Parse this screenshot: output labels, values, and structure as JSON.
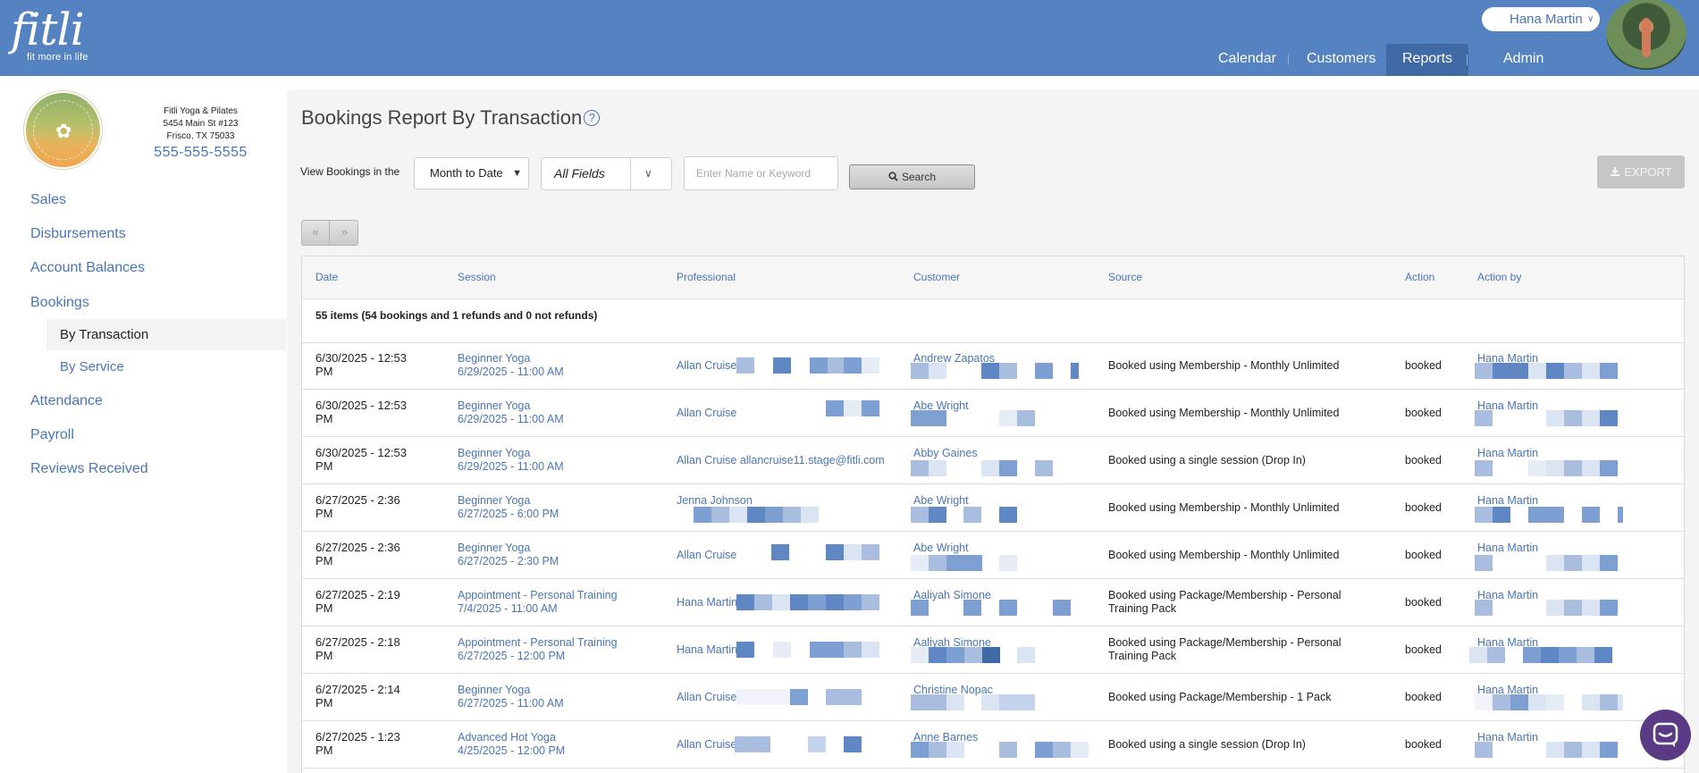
{
  "brand": {
    "name": "fitli",
    "tagline": "fit more in life"
  },
  "user": {
    "name": "Hana Martin"
  },
  "nav": [
    {
      "label": "Calendar",
      "active": false
    },
    {
      "label": "Customers",
      "active": false
    },
    {
      "label": "Reports",
      "active": true
    },
    {
      "label": "Admin",
      "active": false
    }
  ],
  "studio": {
    "name": "Fitli Yoga & Pilates",
    "address1": "5454 Main St #123",
    "address2": "Frisco, TX 75033",
    "phone": "555-555-5555"
  },
  "sidebar": {
    "items": [
      "Sales",
      "Disbursements",
      "Account Balances",
      "Bookings"
    ],
    "sub_items": [
      {
        "label": "By Transaction",
        "active": true
      },
      {
        "label": "By Service",
        "active": false
      }
    ],
    "items_after": [
      "Attendance",
      "Payroll",
      "Reviews Received"
    ]
  },
  "page": {
    "title": "Bookings Report By Transaction",
    "help": "?"
  },
  "filters": {
    "view_label": "View Bookings in the",
    "period": "Month to Date",
    "fields": "All Fields",
    "keyword_placeholder": "Enter Name or Keyword",
    "search_label": "Search",
    "export_label": "EXPORT"
  },
  "pager": {
    "prev": "«",
    "next": "»"
  },
  "table": {
    "columns": [
      "Date",
      "Session",
      "Professional",
      "Customer",
      "Source",
      "Action",
      "Action by"
    ],
    "summary": "55 items (54 bookings and 1 refunds and 0 not refunds)",
    "rows": [
      {
        "date": "6/30/2025 - 12:53",
        "date2": "PM",
        "session": "Beginner Yoga",
        "session_time": "6/29/2025 - 11:00 AM",
        "professional": "Allan Cruise",
        "customer": "Andrew Zapatos",
        "source": "Booked using Membership - Monthly Unlimited",
        "source2": "",
        "action": "booked",
        "action_by": "Hana Martin"
      },
      {
        "date": "6/30/2025 - 12:53",
        "date2": "PM",
        "session": "Beginner Yoga",
        "session_time": "6/29/2025 - 11:00 AM",
        "professional": "Allan Cruise",
        "customer": "Abe Wright",
        "source": "Booked using Membership - Monthly Unlimited",
        "source2": "",
        "action": "booked",
        "action_by": "Hana Martin"
      },
      {
        "date": "6/30/2025 - 12:53",
        "date2": "PM",
        "session": "Beginner Yoga",
        "session_time": "6/29/2025 - 11:00 AM",
        "professional": "Allan Cruise allancruise11.stage@fitli.com",
        "customer": "Abby Gaines",
        "source": "Booked using a single session (Drop In)",
        "source2": "",
        "action": "booked",
        "action_by": "Hana Martin"
      },
      {
        "date": "6/27/2025 - 2:36",
        "date2": "PM",
        "session": "Beginner Yoga",
        "session_time": "6/27/2025 - 6:00 PM",
        "professional": "Jenna Johnson",
        "customer": "Abe Wright",
        "source": "Booked using Membership - Monthly Unlimited",
        "source2": "",
        "action": "booked",
        "action_by": "Hana Martin"
      },
      {
        "date": "6/27/2025 - 2:36",
        "date2": "PM",
        "session": "Beginner Yoga",
        "session_time": "6/27/2025 - 2:30 PM",
        "professional": "Allan Cruise",
        "customer": "Abe Wright",
        "source": "Booked using Membership - Monthly Unlimited",
        "source2": "",
        "action": "booked",
        "action_by": "Hana Martin"
      },
      {
        "date": "6/27/2025 - 2:19",
        "date2": "PM",
        "session": "Appointment - Personal Training",
        "session_time": "7/4/2025 - 11:00 AM",
        "professional": "Hana Martin",
        "customer": "Aaliyah Simone",
        "source": "Booked using Package/Membership - Personal",
        "source2": "Training Pack",
        "action": "booked",
        "action_by": "Hana Martin"
      },
      {
        "date": "6/27/2025 - 2:18",
        "date2": "PM",
        "session": "Appointment - Personal Training",
        "session_time": "6/27/2025 - 12:00 PM",
        "professional": "Hana Martin",
        "customer": "Aaliyah Simone",
        "source": "Booked using Package/Membership - Personal",
        "source2": "Training Pack",
        "action": "booked",
        "action_by": "Hana Martin"
      },
      {
        "date": "6/27/2025 - 2:14",
        "date2": "PM",
        "session": "Beginner Yoga",
        "session_time": "6/27/2025 - 11:00 AM",
        "professional": "Allan Cruise",
        "customer": "Christine Nopac",
        "source": "Booked using Package/Membership - 1 Pack",
        "source2": "",
        "action": "booked",
        "action_by": "Hana Martin"
      },
      {
        "date": "6/27/2025 - 1:23",
        "date2": "PM",
        "session": "Advanced Hot Yoga",
        "session_time": "4/25/2025 - 12:00 PM",
        "professional": "Allan Cruise",
        "customer": "Anne Barnes",
        "source": "Booked using a single session (Drop In)",
        "source2": "",
        "action": "booked",
        "action_by": "Hana Martin"
      }
    ]
  },
  "colors": {
    "header": "#5583c2",
    "link": "#4a76b8",
    "accent_dark": "#3f6aa5",
    "chat": "#5a3a84"
  },
  "icons": {
    "search": "search-icon",
    "download": "download-icon",
    "chat": "chat-icon",
    "help": "help-icon"
  }
}
